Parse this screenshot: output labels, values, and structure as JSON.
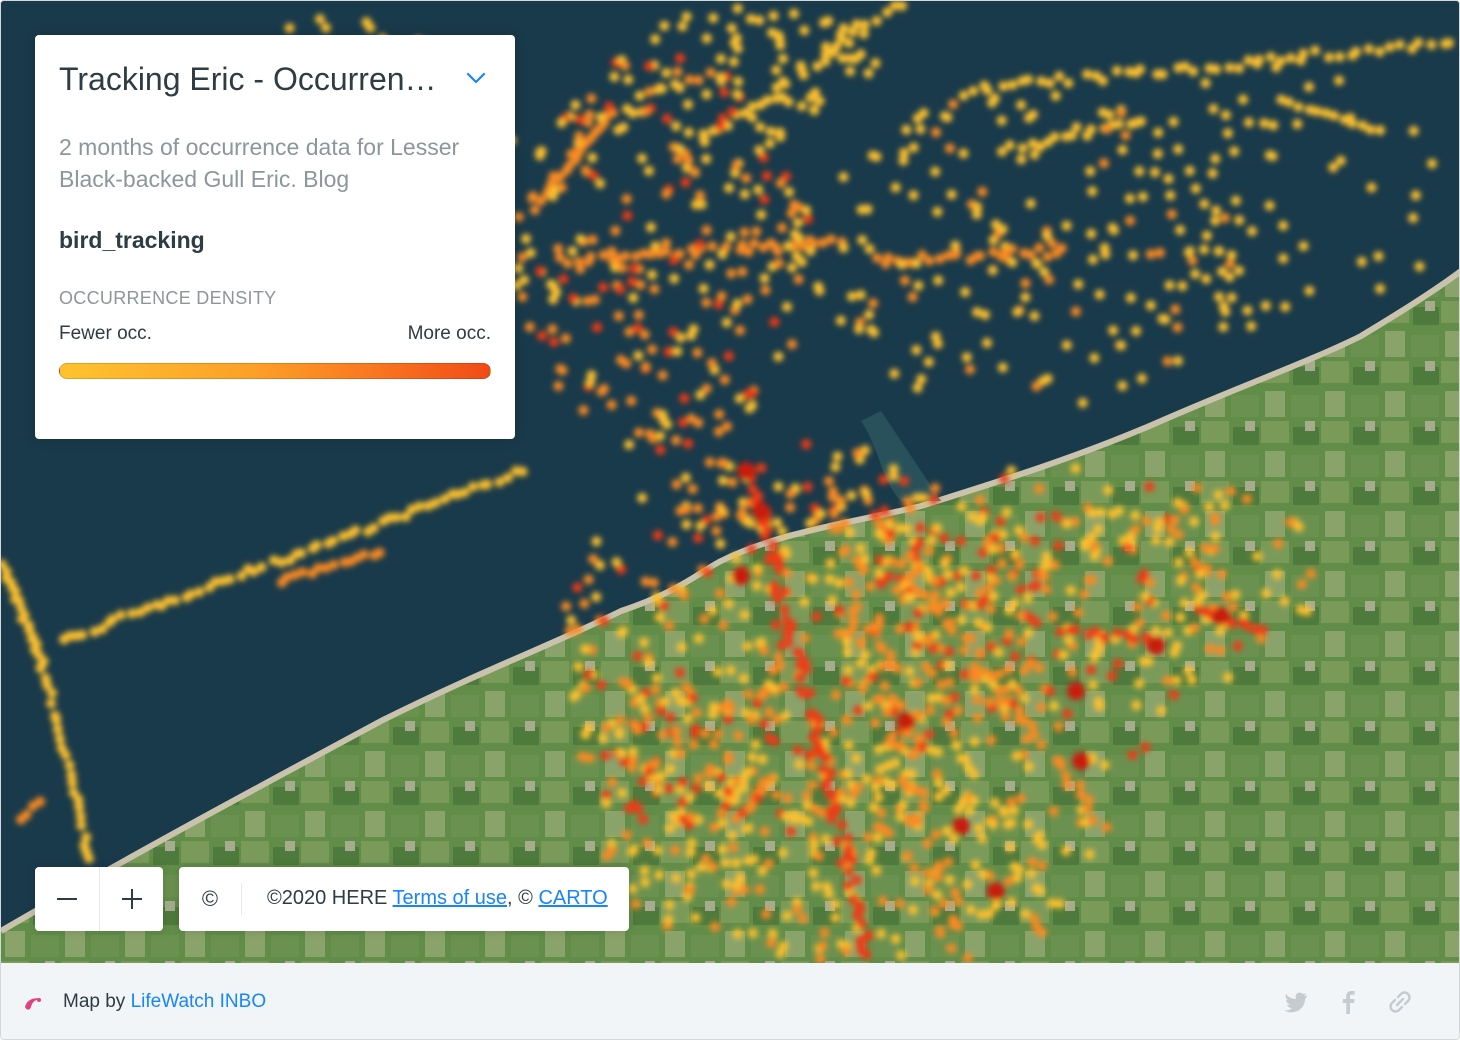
{
  "legend": {
    "title": "Tracking Eric - Occurrence data",
    "description": "2 months of occurrence data for Lesser Black-backed Gull Eric. Blog",
    "layer_name": "bird_tracking",
    "caption": "OCCURRENCE DENSITY",
    "low_label": "Fewer occ.",
    "high_label": "More occ.",
    "ramp_colors": [
      "#ffc32f",
      "#fca027",
      "#f9731f",
      "#f14b16"
    ]
  },
  "zoom": {
    "out_icon": "minus-icon",
    "in_icon": "plus-icon"
  },
  "attribution": {
    "icon_glyph": "©",
    "prefix": "©2020 HERE ",
    "terms_link": "Terms of use",
    "middle": ", © ",
    "carto_link": "CARTO"
  },
  "footer": {
    "map_by": "Map by ",
    "author_link": "LifeWatch INBO",
    "share_icons": [
      "twitter-icon",
      "facebook-icon",
      "link-icon"
    ]
  },
  "map_colors": {
    "sea": "#193a4b",
    "land": "#5f8a4a",
    "point_low": "#fcc02e",
    "point_mid": "#f98a24",
    "point_high": "#ef3a12",
    "accent": "#1785fb"
  }
}
